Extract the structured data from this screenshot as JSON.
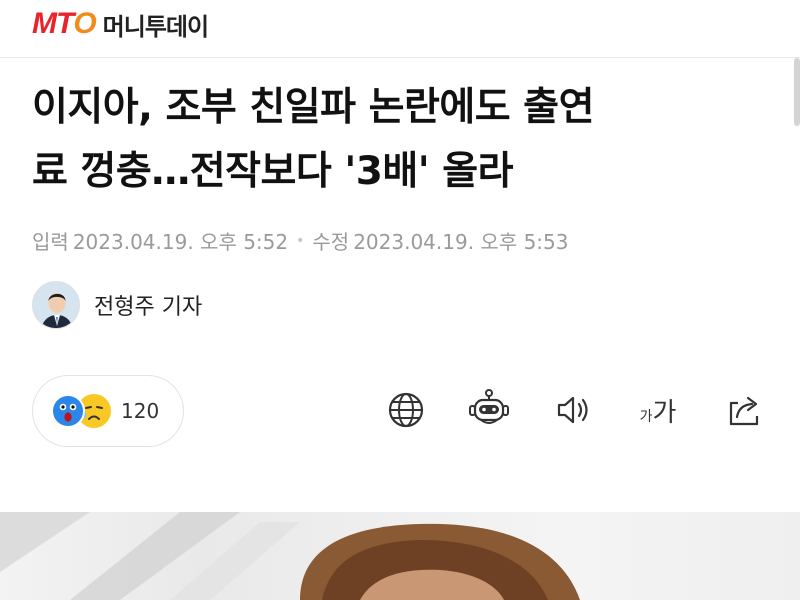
{
  "brand": {
    "logo_mt": "MT",
    "logo_o": "O",
    "name": "머니투데이",
    "colors": {
      "red": "#e8232b",
      "orange": "#f08c1c"
    }
  },
  "article": {
    "headline_line1": "이지아, 조부 친일파 논란에도 출연",
    "headline_line2": "료 껑충…전작보다 '3배' 올라",
    "input_label": "입력",
    "input_date": "2023.04.19. 오후 5:52",
    "dot": "•",
    "edit_label": "수정",
    "edit_date": "2023.04.19. 오후 5:53",
    "author": "전형주 기자"
  },
  "reactions": {
    "icons": [
      "surprised-emoji-icon",
      "sad-emoji-icon"
    ],
    "count": "120"
  },
  "toolbar": {
    "icons": [
      "globe-icon",
      "robot-icon",
      "speaker-icon",
      "font-size-icon",
      "share-icon"
    ],
    "font_small": "가",
    "font_big": "가"
  }
}
